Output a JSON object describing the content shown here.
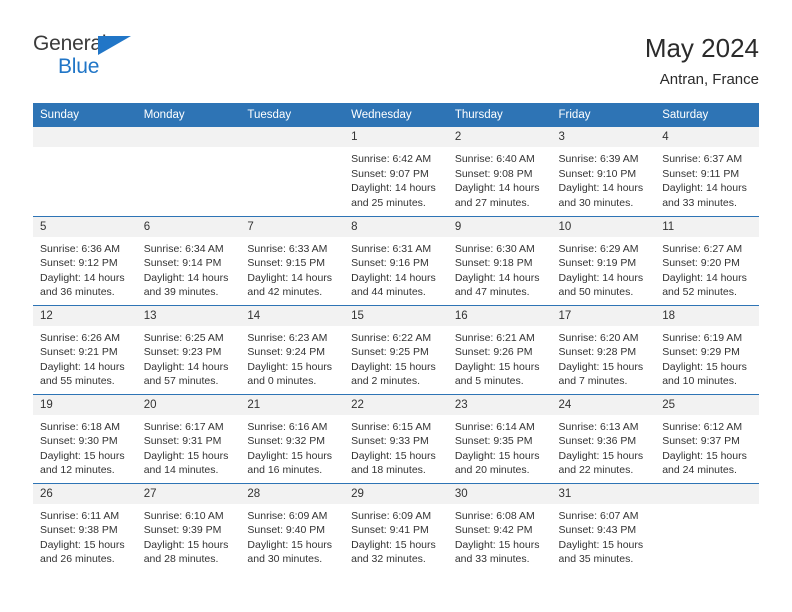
{
  "brand": {
    "name_part1": "General",
    "name_part2": "Blue",
    "triangle_color": "#2176c7"
  },
  "header": {
    "title": "May 2024",
    "location": "Antran, France",
    "header_bg": "#2e74b5",
    "daynum_bg": "#f2f2f2"
  },
  "weekdays": [
    "Sunday",
    "Monday",
    "Tuesday",
    "Wednesday",
    "Thursday",
    "Friday",
    "Saturday"
  ],
  "weeks": [
    [
      {
        "day": "",
        "sunrise": "",
        "sunset": "",
        "daylight1": "",
        "daylight2": ""
      },
      {
        "day": "",
        "sunrise": "",
        "sunset": "",
        "daylight1": "",
        "daylight2": ""
      },
      {
        "day": "",
        "sunrise": "",
        "sunset": "",
        "daylight1": "",
        "daylight2": ""
      },
      {
        "day": "1",
        "sunrise": "Sunrise: 6:42 AM",
        "sunset": "Sunset: 9:07 PM",
        "daylight1": "Daylight: 14 hours",
        "daylight2": "and 25 minutes."
      },
      {
        "day": "2",
        "sunrise": "Sunrise: 6:40 AM",
        "sunset": "Sunset: 9:08 PM",
        "daylight1": "Daylight: 14 hours",
        "daylight2": "and 27 minutes."
      },
      {
        "day": "3",
        "sunrise": "Sunrise: 6:39 AM",
        "sunset": "Sunset: 9:10 PM",
        "daylight1": "Daylight: 14 hours",
        "daylight2": "and 30 minutes."
      },
      {
        "day": "4",
        "sunrise": "Sunrise: 6:37 AM",
        "sunset": "Sunset: 9:11 PM",
        "daylight1": "Daylight: 14 hours",
        "daylight2": "and 33 minutes."
      }
    ],
    [
      {
        "day": "5",
        "sunrise": "Sunrise: 6:36 AM",
        "sunset": "Sunset: 9:12 PM",
        "daylight1": "Daylight: 14 hours",
        "daylight2": "and 36 minutes."
      },
      {
        "day": "6",
        "sunrise": "Sunrise: 6:34 AM",
        "sunset": "Sunset: 9:14 PM",
        "daylight1": "Daylight: 14 hours",
        "daylight2": "and 39 minutes."
      },
      {
        "day": "7",
        "sunrise": "Sunrise: 6:33 AM",
        "sunset": "Sunset: 9:15 PM",
        "daylight1": "Daylight: 14 hours",
        "daylight2": "and 42 minutes."
      },
      {
        "day": "8",
        "sunrise": "Sunrise: 6:31 AM",
        "sunset": "Sunset: 9:16 PM",
        "daylight1": "Daylight: 14 hours",
        "daylight2": "and 44 minutes."
      },
      {
        "day": "9",
        "sunrise": "Sunrise: 6:30 AM",
        "sunset": "Sunset: 9:18 PM",
        "daylight1": "Daylight: 14 hours",
        "daylight2": "and 47 minutes."
      },
      {
        "day": "10",
        "sunrise": "Sunrise: 6:29 AM",
        "sunset": "Sunset: 9:19 PM",
        "daylight1": "Daylight: 14 hours",
        "daylight2": "and 50 minutes."
      },
      {
        "day": "11",
        "sunrise": "Sunrise: 6:27 AM",
        "sunset": "Sunset: 9:20 PM",
        "daylight1": "Daylight: 14 hours",
        "daylight2": "and 52 minutes."
      }
    ],
    [
      {
        "day": "12",
        "sunrise": "Sunrise: 6:26 AM",
        "sunset": "Sunset: 9:21 PM",
        "daylight1": "Daylight: 14 hours",
        "daylight2": "and 55 minutes."
      },
      {
        "day": "13",
        "sunrise": "Sunrise: 6:25 AM",
        "sunset": "Sunset: 9:23 PM",
        "daylight1": "Daylight: 14 hours",
        "daylight2": "and 57 minutes."
      },
      {
        "day": "14",
        "sunrise": "Sunrise: 6:23 AM",
        "sunset": "Sunset: 9:24 PM",
        "daylight1": "Daylight: 15 hours",
        "daylight2": "and 0 minutes."
      },
      {
        "day": "15",
        "sunrise": "Sunrise: 6:22 AM",
        "sunset": "Sunset: 9:25 PM",
        "daylight1": "Daylight: 15 hours",
        "daylight2": "and 2 minutes."
      },
      {
        "day": "16",
        "sunrise": "Sunrise: 6:21 AM",
        "sunset": "Sunset: 9:26 PM",
        "daylight1": "Daylight: 15 hours",
        "daylight2": "and 5 minutes."
      },
      {
        "day": "17",
        "sunrise": "Sunrise: 6:20 AM",
        "sunset": "Sunset: 9:28 PM",
        "daylight1": "Daylight: 15 hours",
        "daylight2": "and 7 minutes."
      },
      {
        "day": "18",
        "sunrise": "Sunrise: 6:19 AM",
        "sunset": "Sunset: 9:29 PM",
        "daylight1": "Daylight: 15 hours",
        "daylight2": "and 10 minutes."
      }
    ],
    [
      {
        "day": "19",
        "sunrise": "Sunrise: 6:18 AM",
        "sunset": "Sunset: 9:30 PM",
        "daylight1": "Daylight: 15 hours",
        "daylight2": "and 12 minutes."
      },
      {
        "day": "20",
        "sunrise": "Sunrise: 6:17 AM",
        "sunset": "Sunset: 9:31 PM",
        "daylight1": "Daylight: 15 hours",
        "daylight2": "and 14 minutes."
      },
      {
        "day": "21",
        "sunrise": "Sunrise: 6:16 AM",
        "sunset": "Sunset: 9:32 PM",
        "daylight1": "Daylight: 15 hours",
        "daylight2": "and 16 minutes."
      },
      {
        "day": "22",
        "sunrise": "Sunrise: 6:15 AM",
        "sunset": "Sunset: 9:33 PM",
        "daylight1": "Daylight: 15 hours",
        "daylight2": "and 18 minutes."
      },
      {
        "day": "23",
        "sunrise": "Sunrise: 6:14 AM",
        "sunset": "Sunset: 9:35 PM",
        "daylight1": "Daylight: 15 hours",
        "daylight2": "and 20 minutes."
      },
      {
        "day": "24",
        "sunrise": "Sunrise: 6:13 AM",
        "sunset": "Sunset: 9:36 PM",
        "daylight1": "Daylight: 15 hours",
        "daylight2": "and 22 minutes."
      },
      {
        "day": "25",
        "sunrise": "Sunrise: 6:12 AM",
        "sunset": "Sunset: 9:37 PM",
        "daylight1": "Daylight: 15 hours",
        "daylight2": "and 24 minutes."
      }
    ],
    [
      {
        "day": "26",
        "sunrise": "Sunrise: 6:11 AM",
        "sunset": "Sunset: 9:38 PM",
        "daylight1": "Daylight: 15 hours",
        "daylight2": "and 26 minutes."
      },
      {
        "day": "27",
        "sunrise": "Sunrise: 6:10 AM",
        "sunset": "Sunset: 9:39 PM",
        "daylight1": "Daylight: 15 hours",
        "daylight2": "and 28 minutes."
      },
      {
        "day": "28",
        "sunrise": "Sunrise: 6:09 AM",
        "sunset": "Sunset: 9:40 PM",
        "daylight1": "Daylight: 15 hours",
        "daylight2": "and 30 minutes."
      },
      {
        "day": "29",
        "sunrise": "Sunrise: 6:09 AM",
        "sunset": "Sunset: 9:41 PM",
        "daylight1": "Daylight: 15 hours",
        "daylight2": "and 32 minutes."
      },
      {
        "day": "30",
        "sunrise": "Sunrise: 6:08 AM",
        "sunset": "Sunset: 9:42 PM",
        "daylight1": "Daylight: 15 hours",
        "daylight2": "and 33 minutes."
      },
      {
        "day": "31",
        "sunrise": "Sunrise: 6:07 AM",
        "sunset": "Sunset: 9:43 PM",
        "daylight1": "Daylight: 15 hours",
        "daylight2": "and 35 minutes."
      },
      {
        "day": "",
        "sunrise": "",
        "sunset": "",
        "daylight1": "",
        "daylight2": ""
      }
    ]
  ]
}
